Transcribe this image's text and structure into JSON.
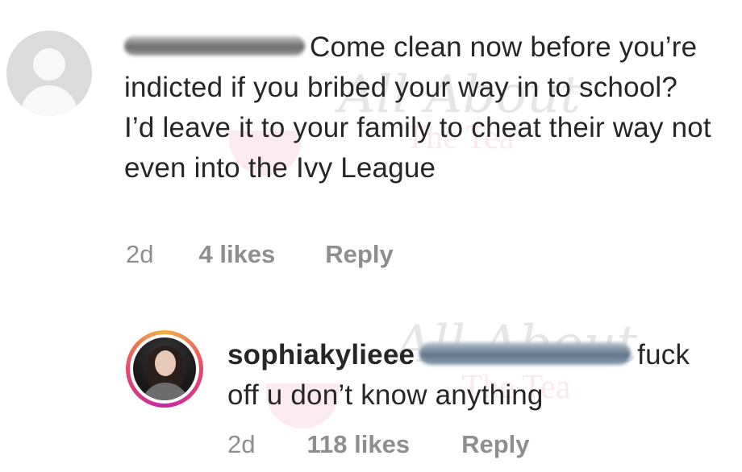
{
  "comments": [
    {
      "username_redacted": true,
      "text": "Come clean now before you’re indicted if you bribed your way in to school?  I’d leave it to your family to cheat their way not even into the Ivy League",
      "time": "2d",
      "likes": "4 likes",
      "reply_label": "Reply"
    }
  ],
  "reply_comment": {
    "username": "sophiakylieee",
    "mention_redacted": true,
    "text": "fuck off u don’t know anything",
    "time": "2d",
    "likes": "118 likes",
    "reply_label": "Reply"
  },
  "watermark": {
    "script": "All About",
    "sub": "The Tea"
  },
  "colors": {
    "text": "#262626",
    "meta": "#8e8e8e",
    "avatar_placeholder": "#dbdbdb",
    "story_ring": "#e8486a"
  },
  "icons": [
    "default-avatar-icon",
    "story-ring-avatar"
  ]
}
